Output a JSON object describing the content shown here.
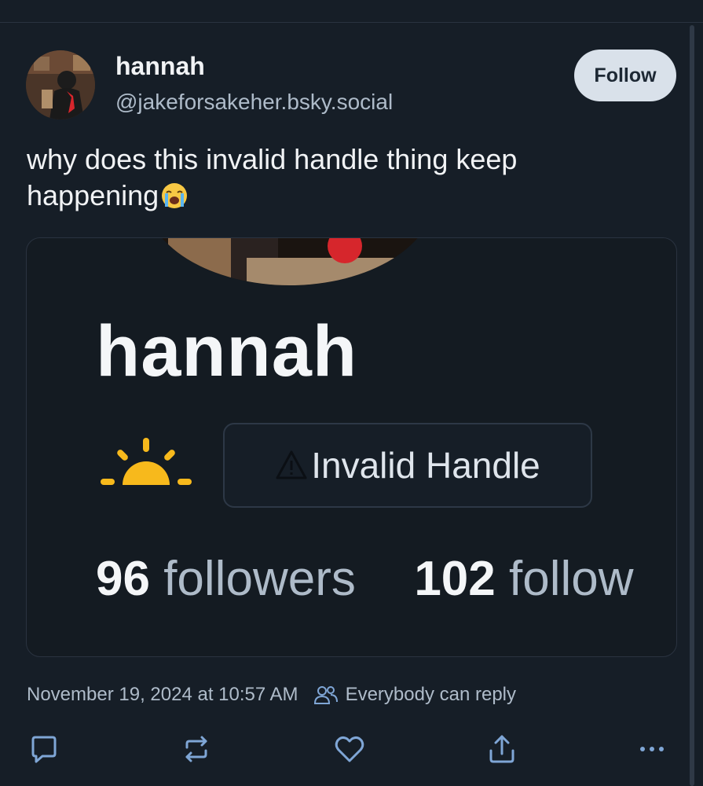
{
  "post": {
    "author": {
      "display_name": "hannah",
      "handle": "@jakeforsakeher.bsky.social"
    },
    "follow_label": "Follow",
    "text": "why does this invalid handle thing keep happening",
    "emoji": "loudly-crying-face",
    "embedded_image": {
      "profile_name": "hannah",
      "badge_text": "Invalid Handle",
      "followers_count": "96",
      "followers_label": "followers",
      "following_count": "102",
      "following_label": "follow"
    },
    "timestamp": "November 19, 2024 at 10:57 AM",
    "reply_setting": "Everybody can reply"
  },
  "actions": [
    "reply-icon",
    "repost-icon",
    "like-icon",
    "share-icon",
    "more-icon"
  ],
  "colors": {
    "background": "#161e27",
    "text": "#f1f3f5",
    "muted": "#aebbc9",
    "follow_button": "#d9e1ea"
  }
}
